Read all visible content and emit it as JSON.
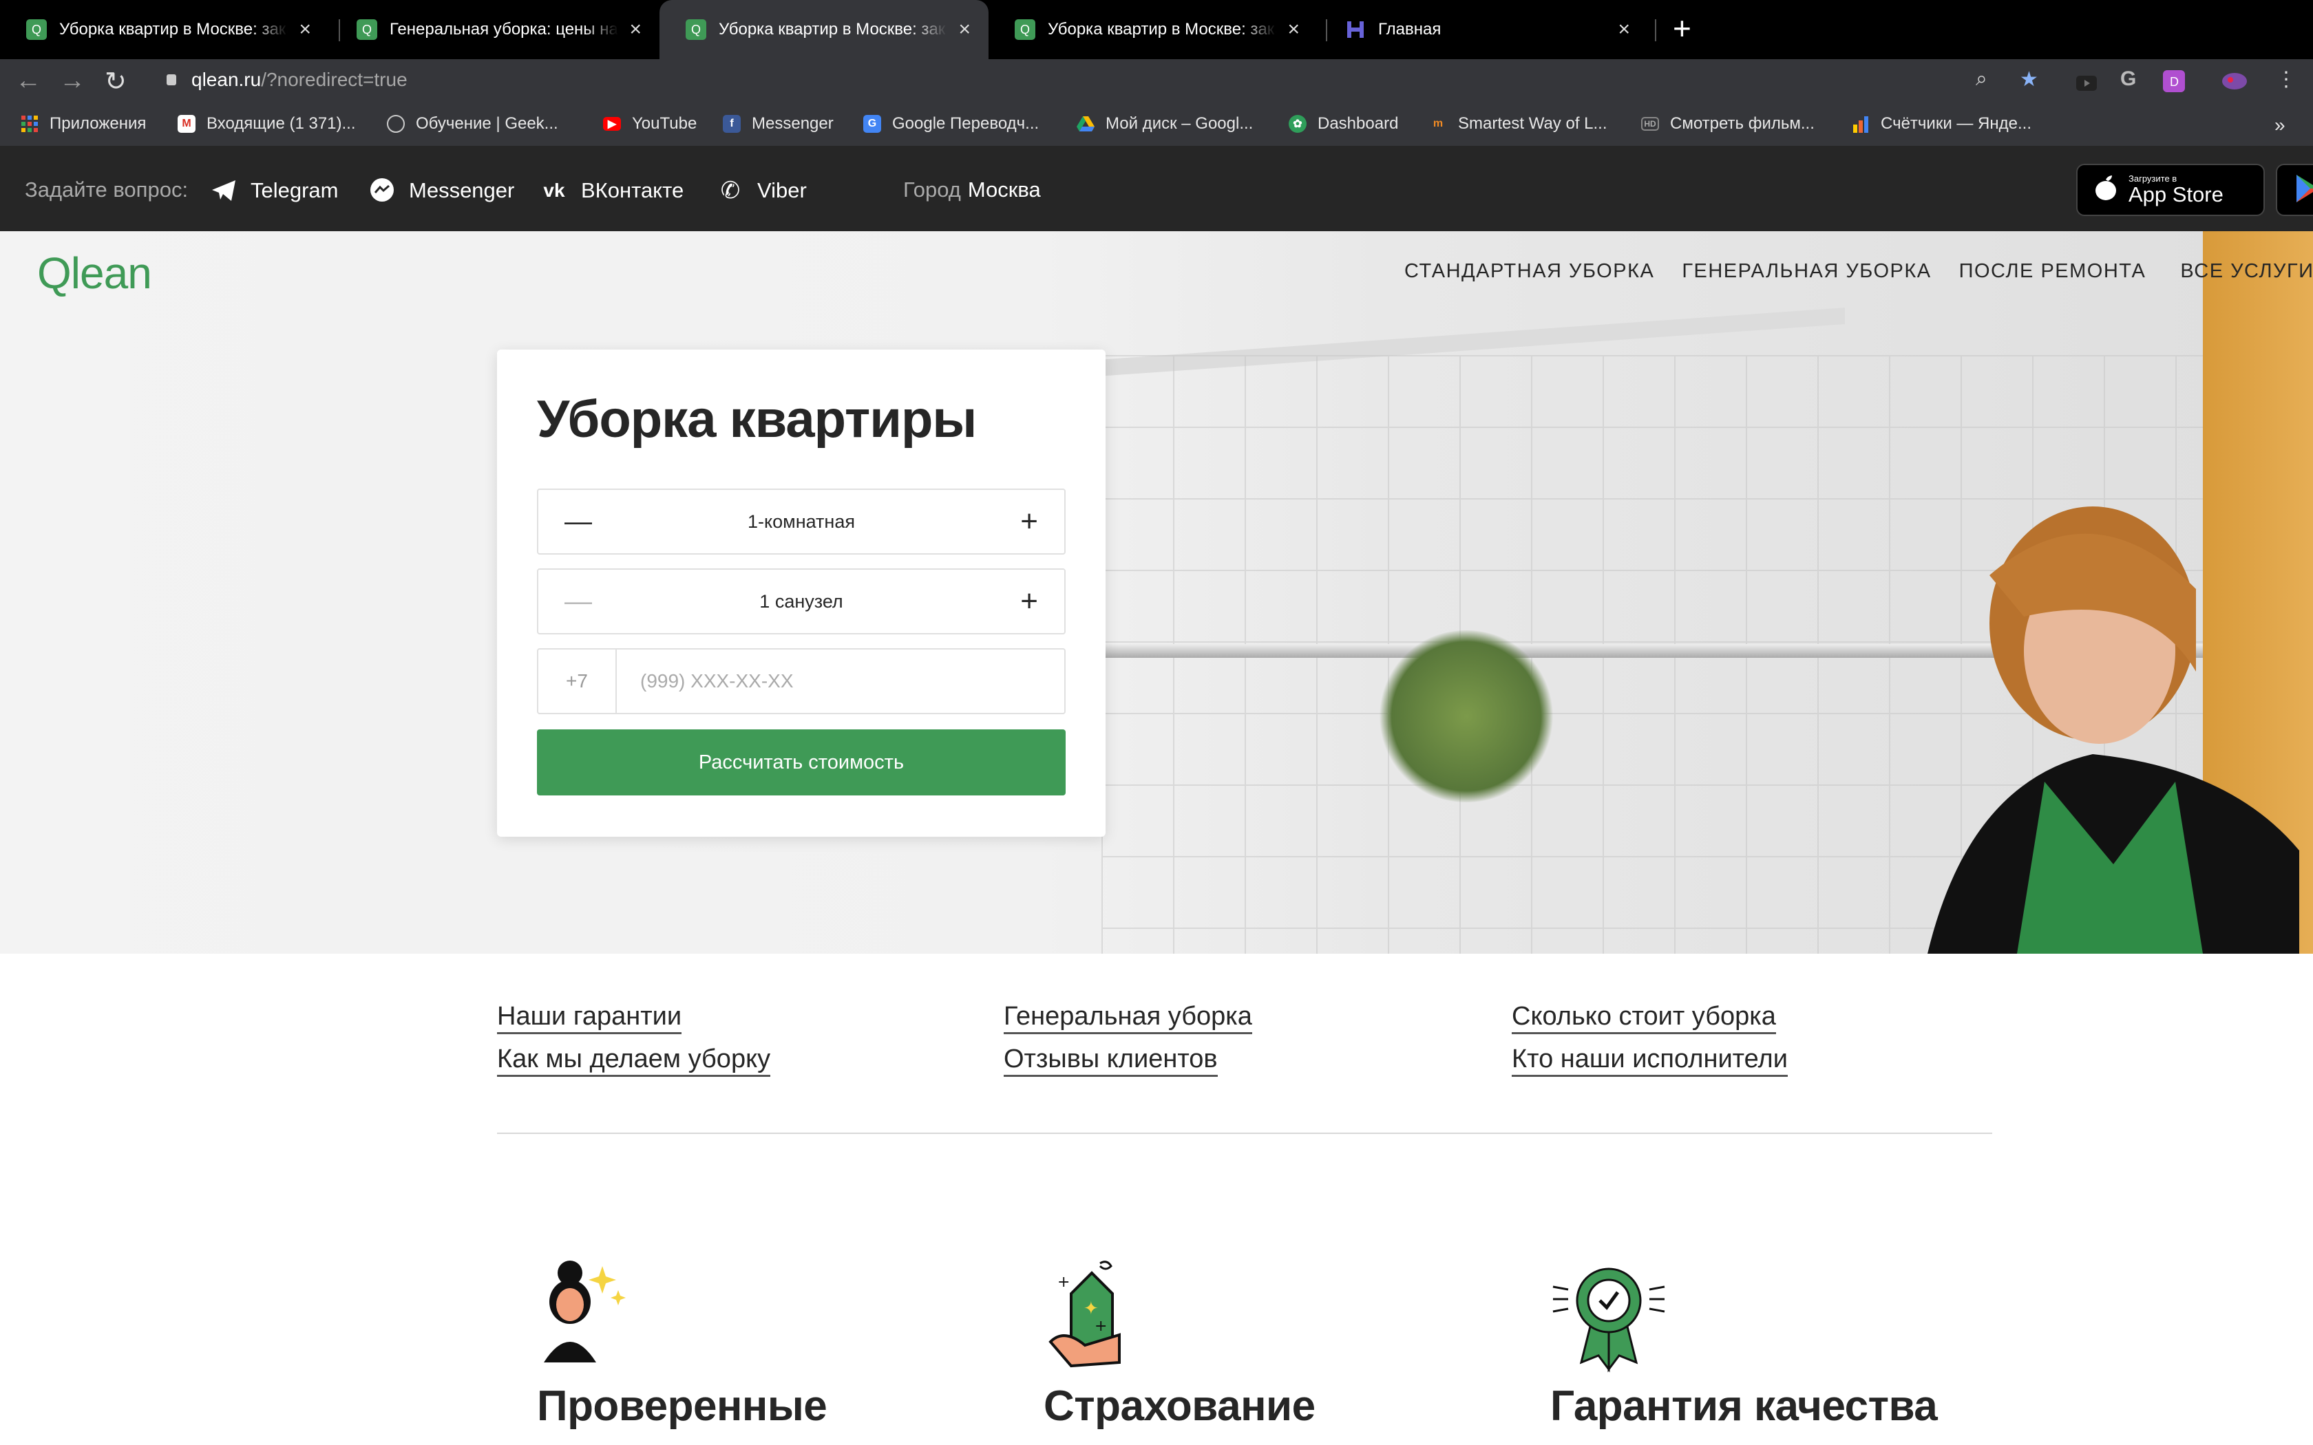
{
  "browser": {
    "tabs": [
      {
        "title": "Уборка квартир в Москве: заказ",
        "active": false,
        "icon": "qlean-favicon"
      },
      {
        "title": "Генеральная уборка: цены на",
        "active": false,
        "icon": "qlean-favicon"
      },
      {
        "title": "Уборка квартир в Москве: заказ",
        "active": true,
        "icon": "qlean-favicon"
      },
      {
        "title": "Уборка квартир в Москве: заказ",
        "active": false,
        "icon": "qlean-favicon"
      },
      {
        "title": "Главная",
        "active": false,
        "icon": "heroku-favicon"
      }
    ],
    "new_tab": "+",
    "close": "×",
    "url_host": "qlean.ru",
    "url_path": "/?noredirect=true",
    "bookmarks": [
      {
        "label": "Приложения",
        "icon": "apps-grid-icon",
        "color": "#e8453c"
      },
      {
        "label": "Входящие (1 371)...",
        "icon": "gmail-icon",
        "color": "#d93025"
      },
      {
        "label": "Обучение | Geek...",
        "icon": "geekbrains-icon",
        "color": "#555555"
      },
      {
        "label": "YouTube",
        "icon": "youtube-icon",
        "color": "#ff0000"
      },
      {
        "label": "Messenger",
        "icon": "facebook-icon",
        "color": "#3b5998"
      },
      {
        "label": "Google Переводч...",
        "icon": "google-translate-icon",
        "color": "#4285f4"
      },
      {
        "label": "Мой диск – Googl...",
        "icon": "google-drive-icon",
        "color": "#1fa463"
      },
      {
        "label": "Dashboard",
        "icon": "dashboard-icon",
        "color": "#2f9e5a"
      },
      {
        "label": "Smartest Way of L...",
        "icon": "smartest-way-icon",
        "color": "#f08a24"
      },
      {
        "label": "Смотреть фильм...",
        "icon": "hd-icon",
        "color": "#777777"
      },
      {
        "label": "Счётчики — Янде...",
        "icon": "yandex-metrica-icon",
        "color": "#ffcc00"
      }
    ],
    "more_bookmarks": "»"
  },
  "site_top": {
    "ask": "Задайте вопрос:",
    "contacts": [
      {
        "label": "Telegram",
        "icon": "telegram-icon"
      },
      {
        "label": "Messenger",
        "icon": "messenger-icon"
      },
      {
        "label": "ВКонтакте",
        "icon": "vk-icon"
      },
      {
        "label": "Viber",
        "icon": "viber-icon"
      }
    ],
    "city_label": "Город",
    "city": "Москва",
    "appstore_small": "Загрузите в",
    "appstore_big": "App Store"
  },
  "header": {
    "logo": "Qlean",
    "nav": [
      "СТАНДАРТНАЯ УБОРКА",
      "ГЕНЕРАЛЬНАЯ УБОРКА",
      "ПОСЛЕ РЕМОНТА",
      "ВСЕ УСЛУГИ"
    ]
  },
  "form": {
    "title": "Уборка квартиры",
    "rooms": "1-комнатная",
    "bathrooms": "1 санузел",
    "minus": "—",
    "plus": "+",
    "phone_code": "+7",
    "phone_placeholder": "(999) XXX-XX-XX",
    "submit": "Рассчитать стоимость"
  },
  "links": [
    [
      "Наши гарантии",
      "Как мы делаем уборку"
    ],
    [
      "Генеральная уборка",
      "Отзывы клиентов"
    ],
    [
      "Сколько стоит уборка",
      "Кто наши исполнители"
    ]
  ],
  "features": [
    {
      "title": "Проверенные",
      "icon": "verified-cleaner-icon"
    },
    {
      "title": "Страхование",
      "icon": "insurance-house-icon"
    },
    {
      "title": "Гарантия качества",
      "icon": "quality-badge-icon"
    }
  ],
  "colors": {
    "brand": "#3f9a56",
    "dark_bar": "#262626",
    "chrome": "#35363a"
  }
}
